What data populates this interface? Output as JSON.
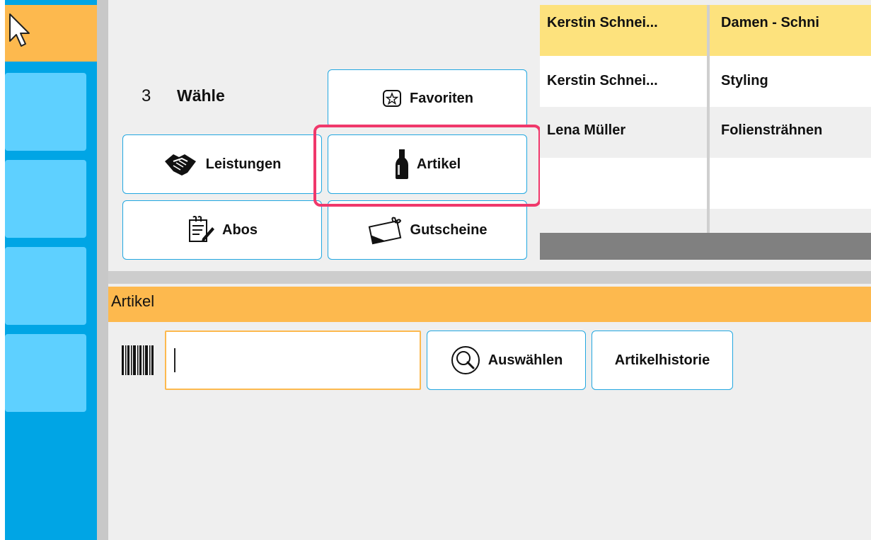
{
  "step": {
    "number": "3",
    "label": "Wähle"
  },
  "buttons": {
    "favoriten": "Favoriten",
    "leistungen": "Leistungen",
    "artikel": "Artikel",
    "abos": "Abos",
    "gutscheine": "Gutscheine"
  },
  "table": {
    "rows": [
      {
        "employee": "Kerstin Schnei...",
        "service": "Damen - Schni",
        "selected": true
      },
      {
        "employee": "Kerstin Schnei...",
        "service": "Styling",
        "selected": false
      },
      {
        "employee": "Lena Müller",
        "service": "Foliensträhnen",
        "selected": false
      },
      {
        "employee": "",
        "service": "",
        "selected": false
      }
    ]
  },
  "artikel_section": {
    "title": "Artikel",
    "search_value": "",
    "select_button": "Auswählen",
    "history_button": "Artikelhistorie"
  },
  "colors": {
    "accent_orange": "#fdb94e",
    "rail_blue": "#00a5e5",
    "tile_blue": "#5ed0ff",
    "highlight_pink": "#f0386b",
    "button_border": "#22a7e0",
    "selected_row": "#fde27d"
  },
  "icons": [
    "pointer-icon",
    "star-icon",
    "handshake-icon",
    "bottle-icon",
    "notepad-icon",
    "gift-card-icon",
    "barcode-icon",
    "magnifier-icon"
  ]
}
